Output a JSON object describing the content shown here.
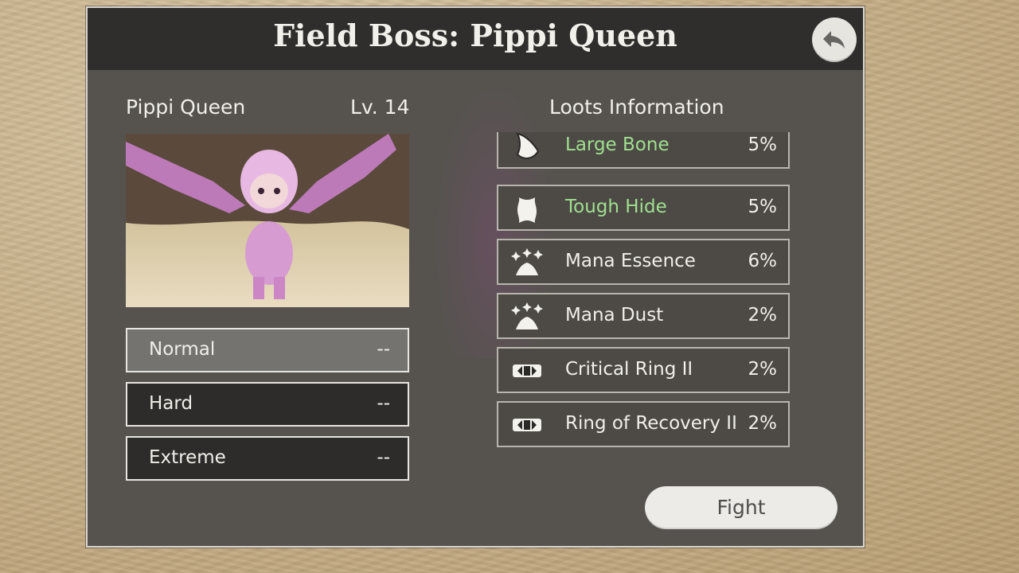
{
  "title": "Field Boss: Pippi Queen",
  "boss": {
    "name": "Pippi Queen",
    "level": "Lv. 14"
  },
  "difficulties": [
    {
      "label": "Normal",
      "value": "--",
      "selected": true
    },
    {
      "label": "Hard",
      "value": "--",
      "selected": false
    },
    {
      "label": "Extreme",
      "value": "--",
      "selected": false
    }
  ],
  "loot_header": "Loots Information",
  "loots": [
    {
      "name": "Large Bone",
      "rate": "5%",
      "icon": "bone-icon",
      "highlight": true
    },
    {
      "name": "Tough Hide",
      "rate": "5%",
      "icon": "hide-icon",
      "highlight": true
    },
    {
      "name": "Mana Essence",
      "rate": "6%",
      "icon": "mana-sparkle-icon",
      "highlight": false
    },
    {
      "name": "Mana Dust",
      "rate": "2%",
      "icon": "mana-sparkle-icon",
      "highlight": false
    },
    {
      "name": "Critical Ring II",
      "rate": "2%",
      "icon": "ring-icon",
      "highlight": false
    },
    {
      "name": "Ring of Recovery II",
      "rate": "2%",
      "icon": "ring-icon",
      "highlight": false
    }
  ],
  "fight_label": "Fight",
  "colors": {
    "highlight_text": "#9fe08f",
    "panel_bg": "#56534f",
    "title_bar_bg": "#2f2e2c",
    "selected_button": "#757370"
  }
}
